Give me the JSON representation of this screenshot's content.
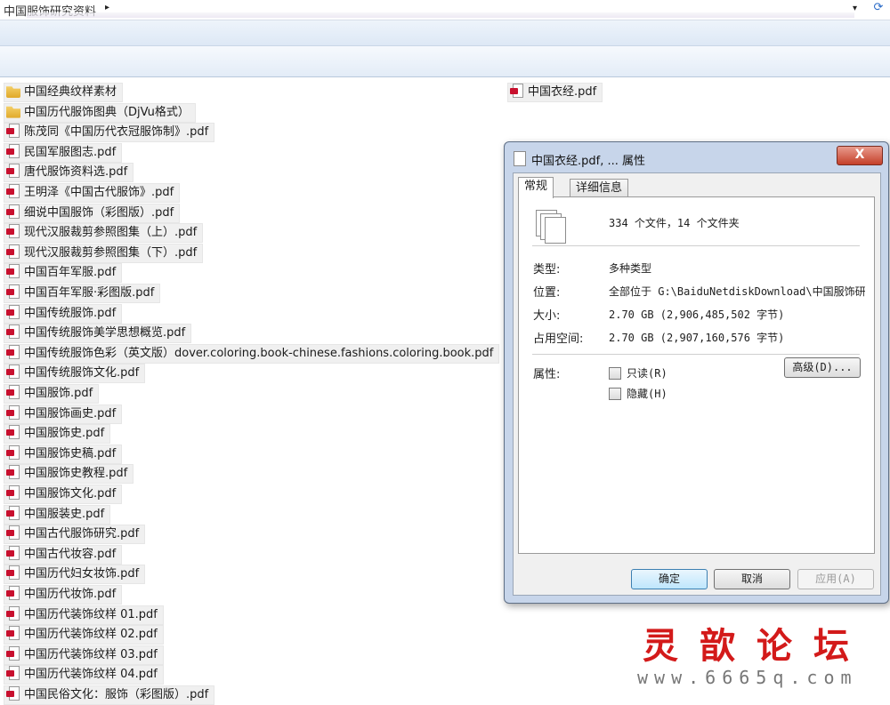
{
  "address_bar": {
    "path": "中国服饰研究资料",
    "arrow": "▸",
    "dropdown": "▾",
    "refresh": "⟳"
  },
  "files": [
    {
      "name": "中国经典纹样素材",
      "kind": "folder"
    },
    {
      "name": "中国历代服饰图典（DjVu格式）",
      "kind": "folder"
    },
    {
      "name": "陈茂同《中国历代衣冠服饰制》.pdf",
      "kind": "pdf"
    },
    {
      "name": "民国军服图志.pdf",
      "kind": "pdf"
    },
    {
      "name": "唐代服饰资料选.pdf",
      "kind": "pdf"
    },
    {
      "name": "王明泽《中国古代服饰》.pdf",
      "kind": "pdf"
    },
    {
      "name": "细说中国服饰（彩图版）.pdf",
      "kind": "pdf"
    },
    {
      "name": "现代汉服裁剪参照图集（上）.pdf",
      "kind": "pdf"
    },
    {
      "name": "现代汉服裁剪参照图集（下）.pdf",
      "kind": "pdf"
    },
    {
      "name": "中国百年军服.pdf",
      "kind": "pdf"
    },
    {
      "name": "中国百年军服·彩图版.pdf",
      "kind": "pdf"
    },
    {
      "name": "中国传统服饰.pdf",
      "kind": "pdf"
    },
    {
      "name": "中国传统服饰美学思想概览.pdf",
      "kind": "pdf"
    },
    {
      "name": "中国传统服饰色彩（英文版）dover.coloring.book-chinese.fashions.coloring.book.pdf",
      "kind": "pdf"
    },
    {
      "name": "中国传统服饰文化.pdf",
      "kind": "pdf"
    },
    {
      "name": "中国服饰.pdf",
      "kind": "pdf"
    },
    {
      "name": "中国服饰画史.pdf",
      "kind": "pdf"
    },
    {
      "name": "中国服饰史.pdf",
      "kind": "pdf"
    },
    {
      "name": "中国服饰史稿.pdf",
      "kind": "pdf"
    },
    {
      "name": "中国服饰史教程.pdf",
      "kind": "pdf"
    },
    {
      "name": "中国服饰文化.pdf",
      "kind": "pdf"
    },
    {
      "name": "中国服装史.pdf",
      "kind": "pdf"
    },
    {
      "name": "中国古代服饰研究.pdf",
      "kind": "pdf"
    },
    {
      "name": "中国古代妆容.pdf",
      "kind": "pdf"
    },
    {
      "name": "中国历代妇女妆饰.pdf",
      "kind": "pdf"
    },
    {
      "name": "中国历代妆饰.pdf",
      "kind": "pdf"
    },
    {
      "name": "中国历代装饰纹样 01.pdf",
      "kind": "pdf"
    },
    {
      "name": "中国历代装饰纹样 02.pdf",
      "kind": "pdf"
    },
    {
      "name": "中国历代装饰纹样 03.pdf",
      "kind": "pdf"
    },
    {
      "name": "中国历代装饰纹样 04.pdf",
      "kind": "pdf"
    },
    {
      "name": "中国民俗文化：服饰（彩图版）.pdf",
      "kind": "pdf"
    }
  ],
  "right_file": {
    "name": "中国衣经.pdf",
    "kind": "pdf"
  },
  "dialog": {
    "title": "中国衣经.pdf, ... 属性",
    "close": "X",
    "tabs": [
      "常规",
      "详细信息"
    ],
    "summary": "334 个文件，14 个文件夹",
    "rows": [
      {
        "label": "类型:",
        "value": "多种类型"
      },
      {
        "label": "位置:",
        "value": "全部位于 G:\\BaiduNetdiskDownload\\中国服饰研"
      },
      {
        "label": "大小:",
        "value": "2.70 GB (2,906,485,502 字节)"
      },
      {
        "label": "占用空间:",
        "value": "2.70 GB (2,907,160,576 字节)"
      }
    ],
    "attributes_label": "属性:",
    "readonly_label": "只读(R)",
    "hidden_label": "隐藏(H)",
    "advanced_button": "高级(D)...",
    "ok_button": "确定",
    "cancel_button": "取消",
    "apply_button": "应用(A)"
  },
  "watermark": {
    "title": "灵歆论坛",
    "url": "www.6665q.com"
  }
}
